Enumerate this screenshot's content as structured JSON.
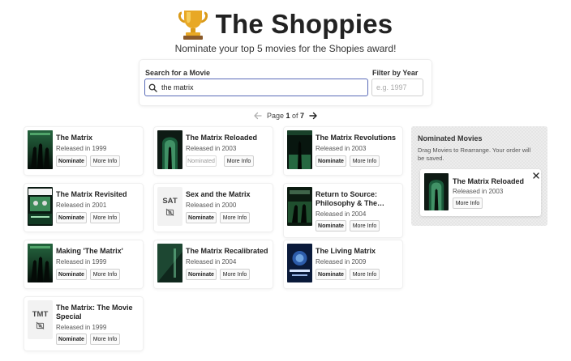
{
  "header": {
    "title": "The Shoppies",
    "subtitle": "Nominate your top 5 movies for the Shopies award!",
    "trophy_icon": "trophy-icon"
  },
  "search": {
    "label": "Search for a Movie",
    "value": "the matrix",
    "year_label": "Filter by Year",
    "year_placeholder": "e.g. 1997",
    "year_value": ""
  },
  "pagination": {
    "prefix": "Page",
    "current": "1",
    "of": "of",
    "total": "7"
  },
  "labels": {
    "nominate": "Nominate",
    "nominated": "Nominated",
    "more_info": "More Info"
  },
  "movies": [
    {
      "title": "The Matrix",
      "released": "Released in 1999",
      "poster": "matrix-green",
      "nominated": false
    },
    {
      "title": "The Matrix Reloaded",
      "released": "Released in 2003",
      "poster": "reloaded",
      "nominated": true
    },
    {
      "title": "The Matrix Revolutions",
      "released": "Released in 2003",
      "poster": "revolutions",
      "nominated": false
    },
    {
      "title": "The Matrix Revisited",
      "released": "Released in 2001",
      "poster": "revisited",
      "nominated": false
    },
    {
      "title": "Sex and the Matrix",
      "released": "Released in 2000",
      "poster": "none",
      "abbr": "SAT",
      "nominated": false
    },
    {
      "title": "Return to Source: Philosophy & The…",
      "released": "Released in 2004",
      "poster": "return-source",
      "nominated": false
    },
    {
      "title": "Making 'The Matrix'",
      "released": "Released in 1999",
      "poster": "matrix-green",
      "nominated": false
    },
    {
      "title": "The Matrix Recalibrated",
      "released": "Released in 2004",
      "poster": "recalibrated",
      "nominated": false
    },
    {
      "title": "The Living Matrix",
      "released": "Released in 2009",
      "poster": "living-matrix",
      "nominated": false
    },
    {
      "title": "The Matrix: The Movie Special",
      "released": "Released in 1999",
      "poster": "none",
      "abbr": "TMT",
      "nominated": false
    }
  ],
  "nominations": {
    "title": "Nominated Movies",
    "description": "Drag Movies to Rearrange. Your order will be saved.",
    "items": [
      {
        "title": "The Matrix Reloaded",
        "released": "Released in 2003",
        "poster": "reloaded"
      }
    ]
  },
  "colors": {
    "accent": "#5a6bb8",
    "trophy": "#e0a023"
  }
}
